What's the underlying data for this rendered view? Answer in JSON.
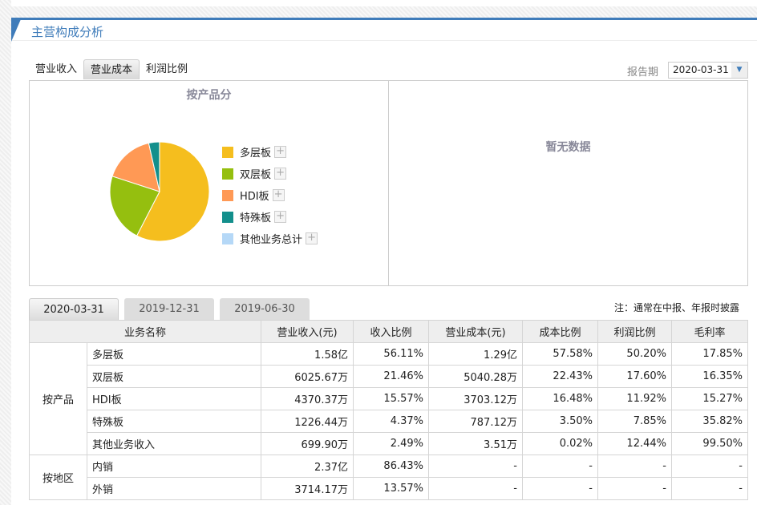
{
  "header": {
    "title": "主营构成分析"
  },
  "tabs": [
    "营业收入",
    "营业成本",
    "利润比例"
  ],
  "period": {
    "label": "报告期",
    "value": "2020-03-31"
  },
  "chart_data": {
    "type": "pie",
    "title": "按产品分",
    "categories": [
      "多层板",
      "双层板",
      "HDI板",
      "特殊板",
      "其他业务总计"
    ],
    "values": [
      57.58,
      22.43,
      16.48,
      3.5,
      0.02
    ],
    "colors": [
      "#f5be1e",
      "#95bf0f",
      "#ff9955",
      "#138f8c",
      "#b5d8f7"
    ],
    "legend": "right"
  },
  "nodata": "暂无数据",
  "date_tabs": [
    "2020-03-31",
    "2019-12-31",
    "2019-06-30"
  ],
  "note": "注：通常在中报、年报时披露",
  "table": {
    "headers": [
      "业务名称",
      "营业收入(元)",
      "收入比例",
      "营业成本(元)",
      "成本比例",
      "利润比例",
      "毛利率"
    ],
    "groups": [
      {
        "name": "按产品",
        "rows": [
          [
            "多层板",
            "1.58亿",
            "56.11%",
            "1.29亿",
            "57.58%",
            "50.20%",
            "17.85%"
          ],
          [
            "双层板",
            "6025.67万",
            "21.46%",
            "5040.28万",
            "22.43%",
            "17.60%",
            "16.35%"
          ],
          [
            "HDI板",
            "4370.37万",
            "15.57%",
            "3703.12万",
            "16.48%",
            "11.92%",
            "15.27%"
          ],
          [
            "特殊板",
            "1226.44万",
            "4.37%",
            "787.12万",
            "3.50%",
            "7.85%",
            "35.82%"
          ],
          [
            "其他业务收入",
            "699.90万",
            "2.49%",
            "3.51万",
            "0.02%",
            "12.44%",
            "99.50%"
          ]
        ]
      },
      {
        "name": "按地区",
        "rows": [
          [
            "内销",
            "2.37亿",
            "86.43%",
            "-",
            "-",
            "-",
            "-"
          ],
          [
            "外销",
            "3714.17万",
            "13.57%",
            "-",
            "-",
            "-",
            "-"
          ]
        ]
      }
    ]
  }
}
